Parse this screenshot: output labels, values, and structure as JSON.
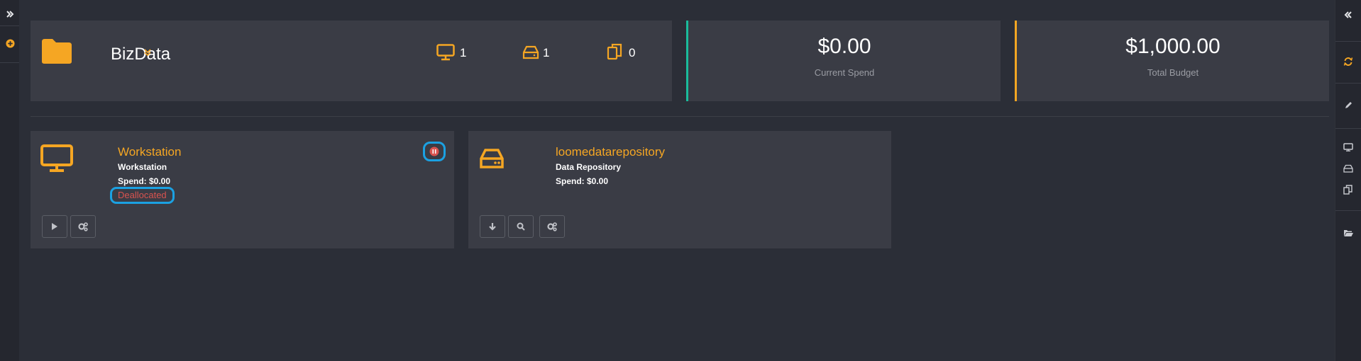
{
  "workspace": {
    "name": "BizData",
    "counts": {
      "workstations": "1",
      "repositories": "1",
      "resources": "0"
    }
  },
  "stats": {
    "current_spend": {
      "value": "$0.00",
      "label": "Current Spend"
    },
    "total_budget": {
      "value": "$1,000.00",
      "label": "Total Budget"
    }
  },
  "cards": [
    {
      "name": "Workstation",
      "type": "Workstation",
      "spend": "Spend: $0.00",
      "status": "Deallocated",
      "icon": "monitor-icon"
    },
    {
      "name": "loomedatarepository",
      "type": "Data Repository",
      "spend": "Spend: $0.00",
      "icon": "hard-drive-icon"
    }
  ],
  "colors": {
    "accent": "#f5a623",
    "spend_border": "#1abc9c",
    "budget_border": "#f5a623",
    "status": "#d9534f",
    "highlight": "#1ba1e2"
  }
}
